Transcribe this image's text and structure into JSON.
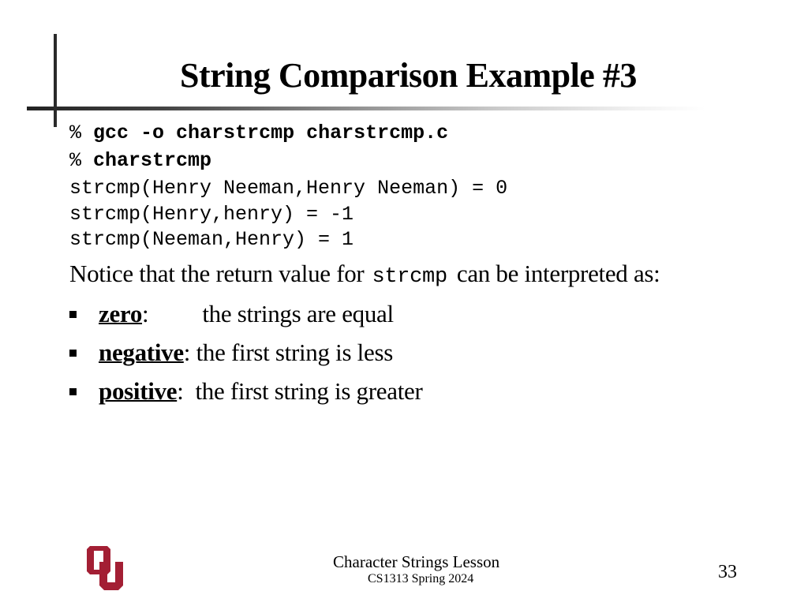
{
  "slide": {
    "title": "String Comparison Example #3",
    "terminal": [
      {
        "prompt": "%",
        "command": "gcc -o charstrcmp charstrcmp.c"
      },
      {
        "prompt": "%",
        "command": "charstrcmp"
      }
    ],
    "output_lines": [
      "strcmp(Henry Neeman,Henry Neeman) = 0",
      "strcmp(Henry,henry) = -1",
      "strcmp(Neeman,Henry) = 1"
    ],
    "notice": {
      "before": "Notice that the return value for",
      "code": "strcmp",
      "after": "can be interpreted as:"
    },
    "bullets": [
      {
        "term": "zero",
        "sep": ":",
        "desc": "the strings are equal"
      },
      {
        "term": "negative",
        "sep": ":",
        "desc": "the first string is less"
      },
      {
        "term": "positive",
        "sep": ":",
        "desc": "the first string is greater"
      }
    ]
  },
  "footer": {
    "lesson": "Character Strings Lesson",
    "course": "CS1313 Spring 2024",
    "page_number": "33",
    "logo": "ou-logo",
    "logo_color": "#a31f34"
  }
}
